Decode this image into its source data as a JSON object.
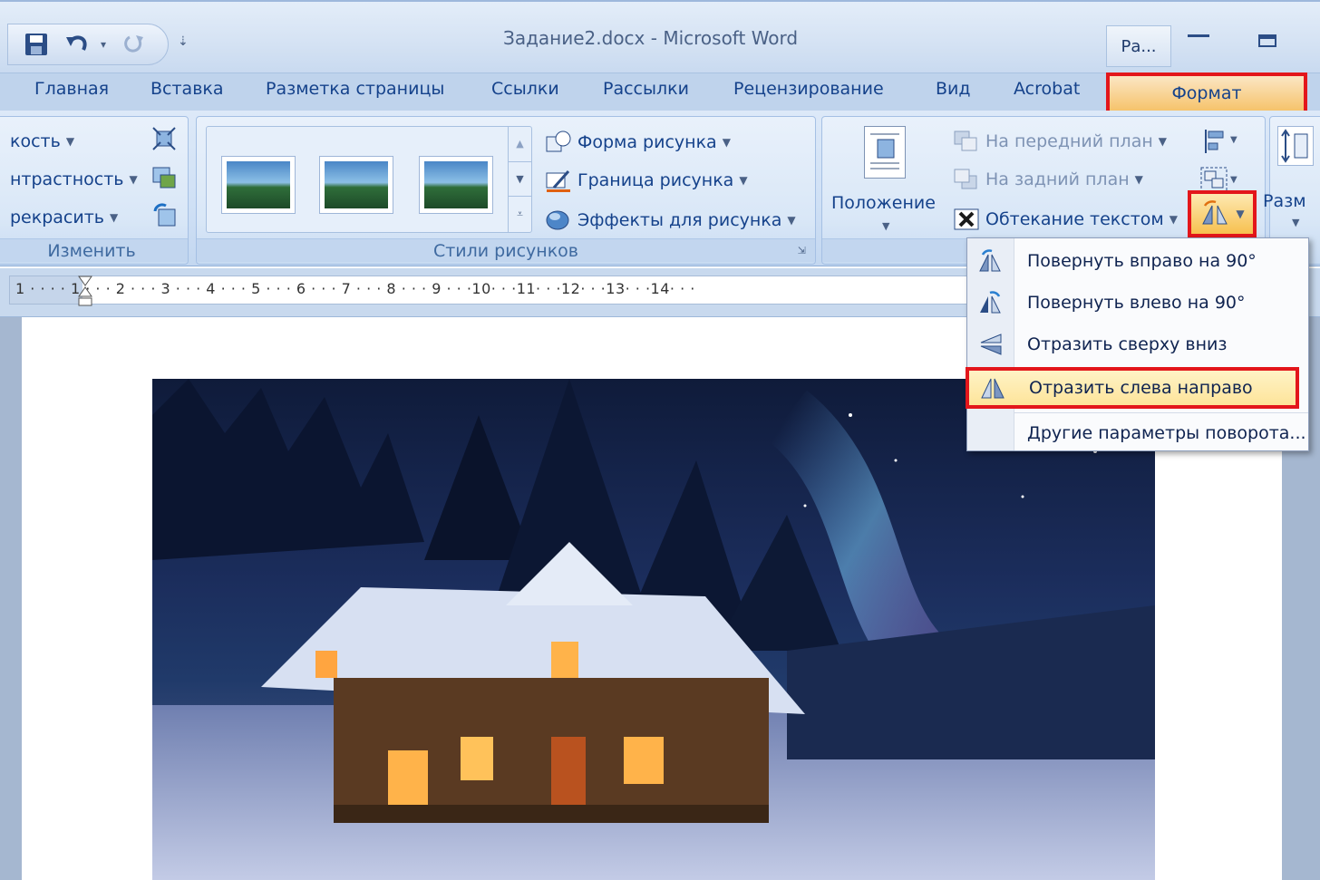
{
  "window": {
    "title": "Задание2.docx - Microsoft Word",
    "tab_overflow_label": "Ра..."
  },
  "tabs": [
    {
      "label": "Главная"
    },
    {
      "label": "Вставка"
    },
    {
      "label": "Разметка страницы"
    },
    {
      "label": "Ссылки"
    },
    {
      "label": "Рассылки"
    },
    {
      "label": "Рецензирование"
    },
    {
      "label": "Вид"
    },
    {
      "label": "Acrobat"
    },
    {
      "label": "Формат",
      "active": true
    }
  ],
  "ribbon": {
    "adjust": {
      "items": [
        "кость",
        "нтрастность",
        "рекрасить"
      ],
      "label": "Изменить"
    },
    "styles": {
      "commands": [
        "Форма рисунка",
        "Граница рисунка",
        "Эффекты для рисунка"
      ],
      "label": "Стили рисунков"
    },
    "arrange": {
      "position_label": "Положение",
      "bring_front": "На передний план",
      "send_back": "На задний план",
      "text_wrap": "Обтекание текстом"
    },
    "size": {
      "label_partial": "Разм"
    }
  },
  "ruler": {
    "text": "1 · · · · 1 · · · 2 · · · 3 · · · 4 · · · 5 · · · 6 · · · 7 · · · 8 · · · 9 · · ·10· · ·11· · ·12· · ·13· · ·14· · ·"
  },
  "rotate_menu": {
    "items": [
      {
        "label": "Повернуть вправо на 90°",
        "icon": "rotate-right-icon"
      },
      {
        "label": "Повернуть влево на 90°",
        "icon": "rotate-left-icon"
      },
      {
        "label": "Отразить сверху вниз",
        "icon": "flip-vertical-icon"
      },
      {
        "label": "Отразить слева направо",
        "icon": "flip-horizontal-icon",
        "highlighted": true
      },
      {
        "label": "Другие параметры поворота...",
        "icon": ""
      }
    ]
  },
  "colors": {
    "highlight_border": "#e3161b",
    "active_tab": "#f6c36b",
    "ribbon": "#cfe0f5"
  }
}
